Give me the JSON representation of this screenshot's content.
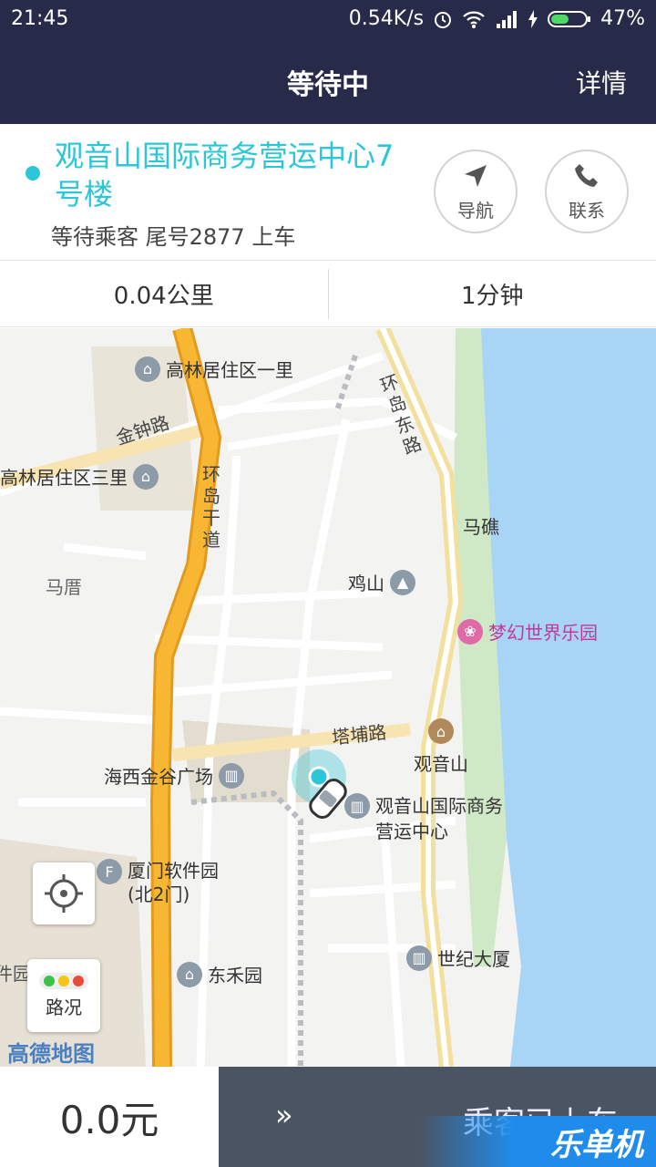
{
  "status_bar": {
    "time": "21:45",
    "network_speed": "0.54K/s",
    "battery": "47%"
  },
  "header": {
    "title": "等待中",
    "detail_label": "详情"
  },
  "destination": {
    "address": "观音山国际商务营运中心7号楼",
    "status": "等待乘客 尾号2877 上车",
    "navigate_label": "导航",
    "contact_label": "联系"
  },
  "stats": {
    "distance": "0.04公里",
    "time": "1分钟"
  },
  "map": {
    "labels": {
      "gaolin1": "高林居住区一里",
      "gaolin3": "高林居住区三里",
      "jinzhong": "金钟路",
      "huandao_gan": "环岛干道",
      "huandao_dong": "环岛东路",
      "maqiao": "马礁",
      "jishan": "鸡山",
      "madang": "马厝",
      "dreamworld": "梦幻世界乐园",
      "tapu": "塔埔路",
      "guanyinshan": "观音山",
      "haixi": "海西金谷广场",
      "gys_center": "观音山国际商务营运中心",
      "software_park": "厦门软件园 (北2门)",
      "shiji": "世纪大厦",
      "donghe": "东禾园",
      "partial_left": "件园"
    },
    "traffic_label": "路况",
    "logo": "高德地图"
  },
  "bottom": {
    "fare": "0.0元",
    "arrows": "»",
    "action_label": "乘客已上车",
    "watermark": "乐单机"
  },
  "colors": {
    "header_bg": "#272a48",
    "accent": "#2bc6d8",
    "water": "#a8d4f5",
    "trunk_road": "#f7b733",
    "bottom_bg": "#4b5463"
  }
}
